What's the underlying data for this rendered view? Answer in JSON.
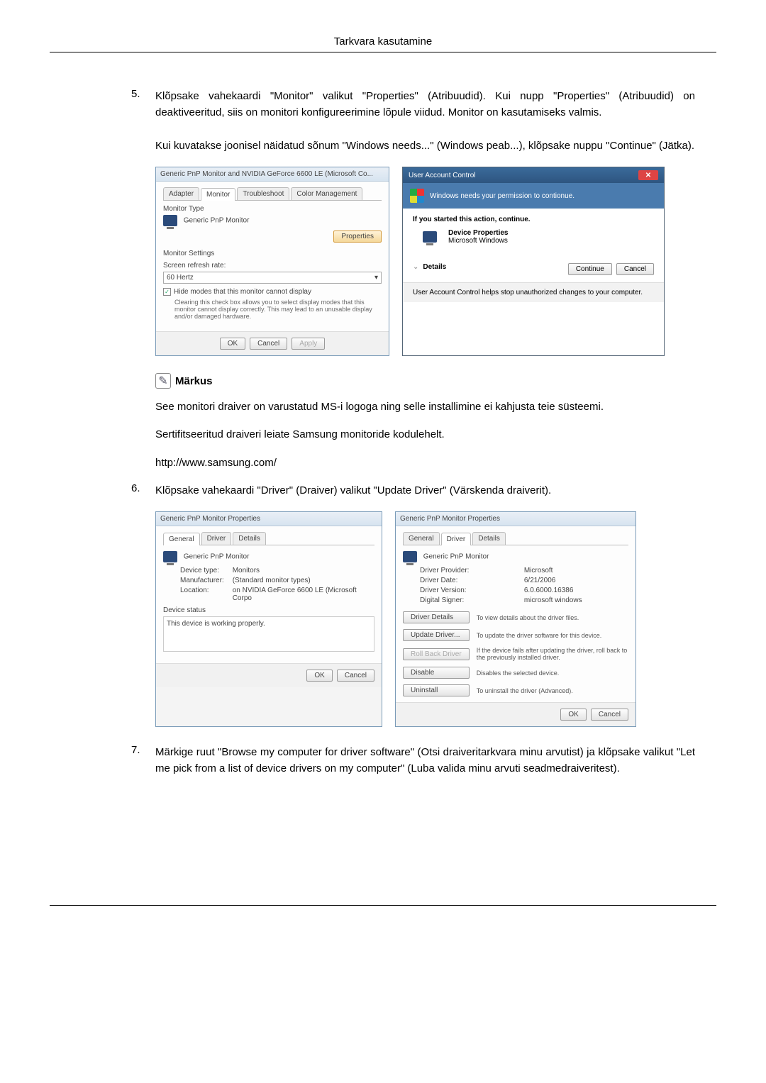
{
  "header": {
    "title": "Tarkvara kasutamine"
  },
  "steps": {
    "s5": {
      "num": "5.",
      "text": "Klõpsake vahekaardi \"Monitor\" valikut \"Properties\" (Atribuudid). Kui nupp \"Properties\" (Atribuudid) on deaktiveeritud, siis on monitori konfigureerimine lõpule viidud. Monitor on kasutamiseks valmis.",
      "followup": "Kui kuvatakse joonisel näidatud sõnum \"Windows needs...\" (Windows peab...), klõpsake nuppu \"Continue\" (Jätka)."
    },
    "s6": {
      "num": "6.",
      "text": "Klõpsake vahekaardi \"Driver\" (Draiver) valikut \"Update Driver\" (Värskenda draiverit)."
    },
    "s7": {
      "num": "7.",
      "text": "Märkige ruut \"Browse my computer for driver software\" (Otsi draiveritarkvara minu arvutist) ja klõpsake valikut \"Let me pick from a list of device drivers on my computer\" (Luba valida minu arvuti seadmedraiveritest)."
    }
  },
  "note": {
    "title": "Märkus",
    "p1": "See monitori draiver on varustatud MS-i logoga ning selle installimine ei kahjusta teie süsteemi.",
    "p2": "Sertifitseeritud draiveri leiate Samsung monitoride kodulehelt.",
    "url": "http://www.samsung.com/"
  },
  "monitorDialog": {
    "title": "Generic PnP Monitor and NVIDIA GeForce 6600 LE (Microsoft Co...",
    "tabs": {
      "adapter": "Adapter",
      "monitor": "Monitor",
      "troubleshoot": "Troubleshoot",
      "color": "Color Management"
    },
    "monitorType": "Monitor Type",
    "monitorName": "Generic PnP Monitor",
    "propertiesBtn": "Properties",
    "monitorSettings": "Monitor Settings",
    "refreshLabel": "Screen refresh rate:",
    "refreshValue": "60 Hertz",
    "hideModes": "Hide modes that this monitor cannot display",
    "hideModesDesc": "Clearing this check box allows you to select display modes that this monitor cannot display correctly. This may lead to an unusable display and/or damaged hardware.",
    "ok": "OK",
    "cancel": "Cancel",
    "apply": "Apply"
  },
  "uac": {
    "title": "User Account Control",
    "banner": "Windows needs your permission to contionue.",
    "started": "If you started this action, continue.",
    "devProps": "Device Properties",
    "msWindows": "Microsoft Windows",
    "details": "Details",
    "continue": "Continue",
    "cancel": "Cancel",
    "footer": "User Account Control helps stop unauthorized changes to your computer."
  },
  "propsGeneral": {
    "title": "Generic PnP Monitor Properties",
    "tabs": {
      "general": "General",
      "driver": "Driver",
      "details": "Details"
    },
    "deviceName": "Generic PnP Monitor",
    "deviceTypeLabel": "Device type:",
    "deviceTypeValue": "Monitors",
    "manufacturerLabel": "Manufacturer:",
    "manufacturerValue": "(Standard monitor types)",
    "locationLabel": "Location:",
    "locationValue": "on NVIDIA GeForce 6600 LE (Microsoft Corpo",
    "deviceStatusLabel": "Device status",
    "deviceStatusValue": "This device is working properly.",
    "ok": "OK",
    "cancel": "Cancel"
  },
  "propsDriver": {
    "title": "Generic PnP Monitor Properties",
    "deviceName": "Generic PnP Monitor",
    "providerLabel": "Driver Provider:",
    "providerValue": "Microsoft",
    "dateLabel": "Driver Date:",
    "dateValue": "6/21/2006",
    "versionLabel": "Driver Version:",
    "versionValue": "6.0.6000.16386",
    "signerLabel": "Digital Signer:",
    "signerValue": "microsoft windows",
    "driverDetails": "Driver Details",
    "driverDetailsDesc": "To view details about the driver files.",
    "updateDriver": "Update Driver...",
    "updateDriverDesc": "To update the driver software for this device.",
    "rollBack": "Roll Back Driver",
    "rollBackDesc": "If the device fails after updating the driver, roll back to the previously installed driver.",
    "disable": "Disable",
    "disableDesc": "Disables the selected device.",
    "uninstall": "Uninstall",
    "uninstallDesc": "To uninstall the driver (Advanced).",
    "ok": "OK",
    "cancel": "Cancel"
  }
}
